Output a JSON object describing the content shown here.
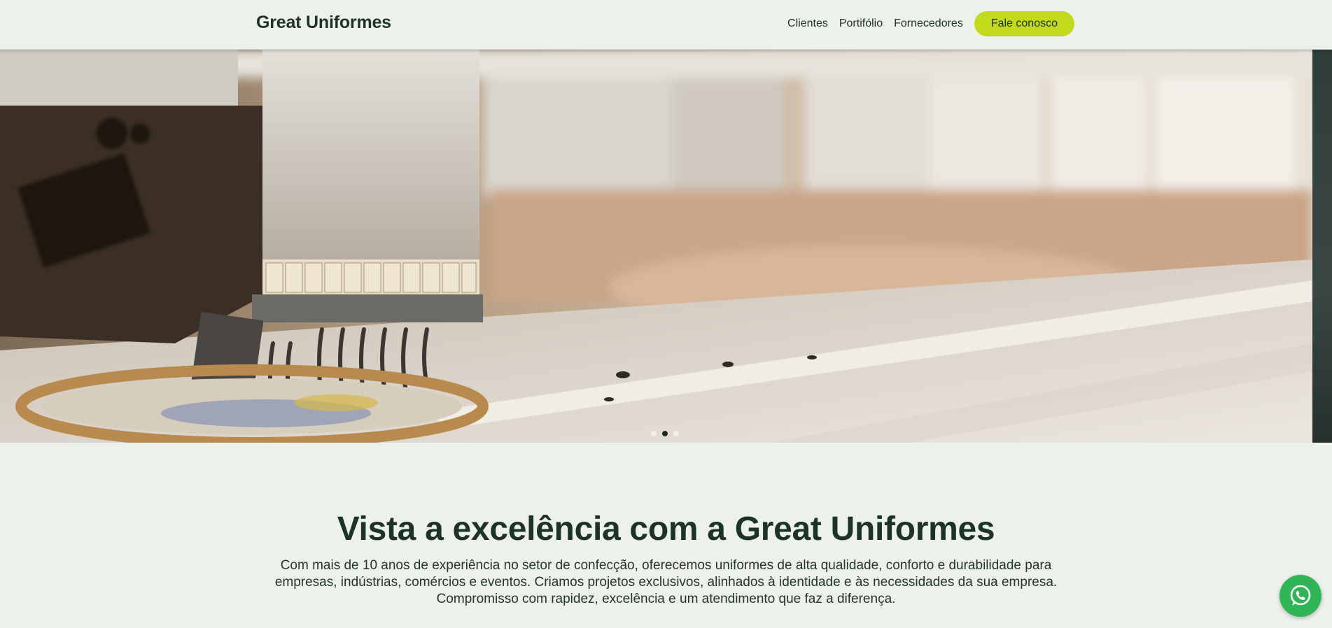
{
  "brand": {
    "name": "Great Uniformes"
  },
  "nav": {
    "links": [
      "Clientes",
      "Portifólio",
      "Fornecedores"
    ],
    "cta_label": "Fale conosco"
  },
  "hero": {
    "image": "embroidery-machine-photo",
    "slide_count": 3,
    "active_slide": 2
  },
  "intro": {
    "heading": "Vista a excelência com a Great Uniformes",
    "paragraph_lines": [
      "Com mais de 10 anos de experiência no setor de confecção, oferecemos uniformes de alta qualidade, conforto e durabilidade para",
      "empresas, indústrias, comércios e eventos. Criamos projetos exclusivos, alinhados à identidade e às necessidades da sua empresa.",
      "Compromisso com rapidez, excelência e um atendimento que faz a diferença."
    ]
  },
  "floating": {
    "icon": "whatsapp-icon"
  },
  "colors": {
    "background": "#ecf1ec",
    "text": "#1e3327",
    "accent": "#c3d91c",
    "whatsapp": "#2fb556"
  }
}
